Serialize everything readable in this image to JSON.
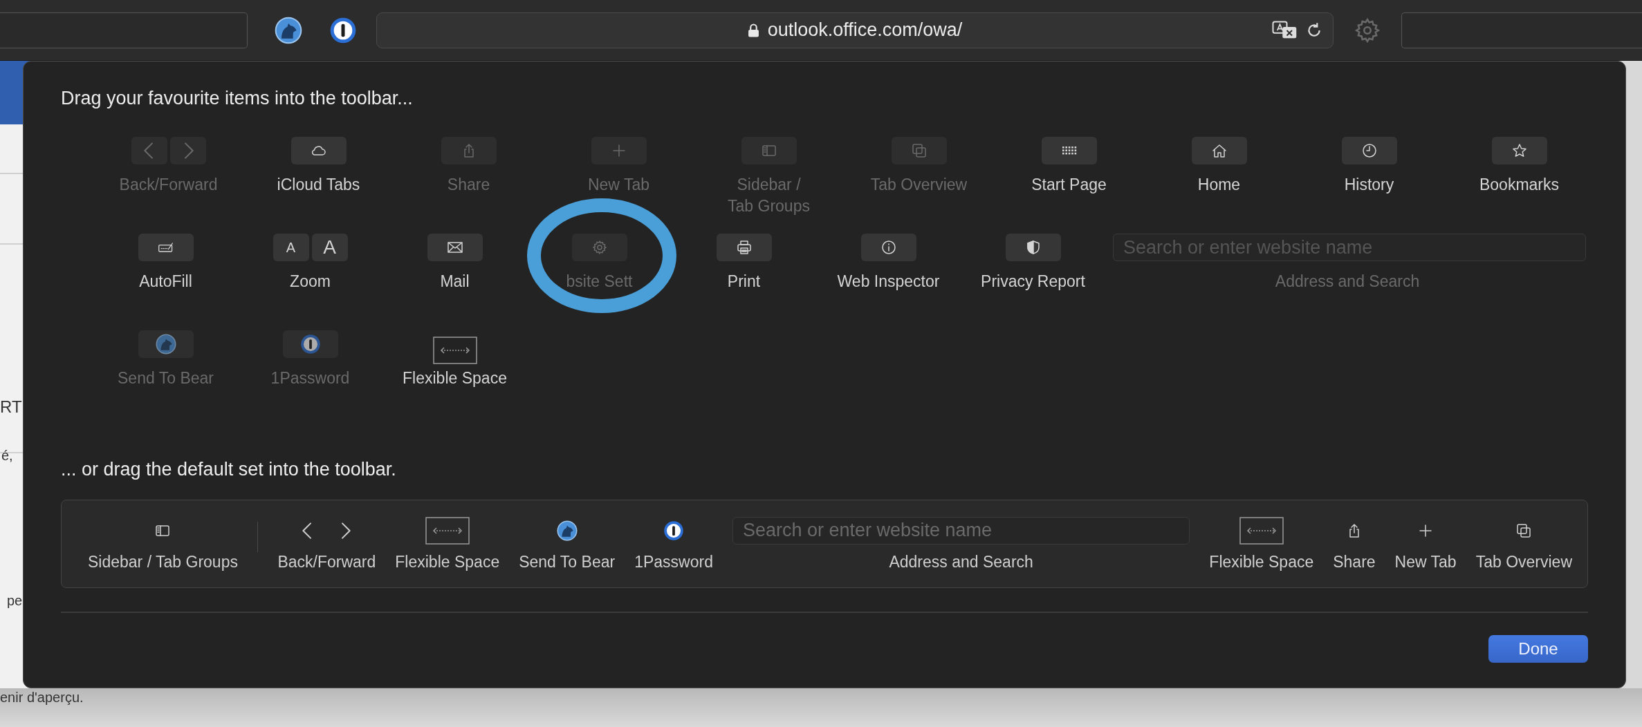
{
  "browser_toolbar": {
    "address": "outlook.office.com/owa/"
  },
  "background_page": {
    "fragments": [
      "RT",
      "é,",
      "pe",
      "enir d'aperçu."
    ]
  },
  "sheet": {
    "title": "Drag your favourite items into the toolbar...",
    "palette": [
      {
        "label": "Back/Forward",
        "kind": "pair",
        "disabled": true
      },
      {
        "label": "iCloud Tabs",
        "kind": "button",
        "disabled": false
      },
      {
        "label": "Share",
        "kind": "button",
        "disabled": true
      },
      {
        "label": "New Tab",
        "kind": "button",
        "disabled": true
      },
      {
        "label": "Sidebar /\nTab Groups",
        "kind": "button",
        "disabled": true
      },
      {
        "label": "Tab Overview",
        "kind": "button",
        "disabled": true
      },
      {
        "label": "Start Page",
        "kind": "button",
        "disabled": false
      },
      {
        "label": "Home",
        "kind": "button",
        "disabled": false
      },
      {
        "label": "History",
        "kind": "button",
        "disabled": false
      },
      {
        "label": "Bookmarks",
        "kind": "button",
        "disabled": false
      },
      {
        "label": "AutoFill",
        "kind": "button",
        "disabled": false
      },
      {
        "label": "Zoom",
        "kind": "letters",
        "glyphs": [
          "A",
          "A"
        ],
        "disabled": false
      },
      {
        "label": "Mail",
        "kind": "button",
        "disabled": false
      },
      {
        "label": "bsite Sett",
        "kind": "button",
        "disabled": true
      },
      {
        "label": "Print",
        "kind": "button",
        "disabled": false
      },
      {
        "label": "Web Inspector",
        "kind": "button",
        "disabled": false
      },
      {
        "label": "Privacy Report",
        "kind": "button",
        "disabled": false
      },
      {
        "label": "Address and Search",
        "kind": "field",
        "placeholder": "Search or enter website name",
        "disabled": true
      },
      {
        "label": "Send To Bear",
        "kind": "button",
        "disabled": true
      },
      {
        "label": "1Password",
        "kind": "button",
        "disabled": true
      },
      {
        "label": "Flexible Space",
        "kind": "space",
        "disabled": false
      }
    ],
    "default_title": "... or drag the default set into the toolbar.",
    "default_set": [
      {
        "label": "Sidebar / Tab Groups",
        "kind": "icon"
      },
      {
        "kind": "separator"
      },
      {
        "label": "Back/Forward",
        "kind": "pair"
      },
      {
        "label": "Flexible Space",
        "kind": "space"
      },
      {
        "label": "Send To Bear",
        "kind": "icon"
      },
      {
        "label": "1Password",
        "kind": "icon"
      },
      {
        "label": "Address and Search",
        "kind": "field",
        "placeholder": "Search or enter website name"
      },
      {
        "label": "Flexible Space",
        "kind": "space"
      },
      {
        "label": "Share",
        "kind": "icon"
      },
      {
        "label": "New Tab",
        "kind": "icon"
      },
      {
        "label": "Tab Overview",
        "kind": "icon"
      }
    ],
    "done_button": "Done"
  }
}
